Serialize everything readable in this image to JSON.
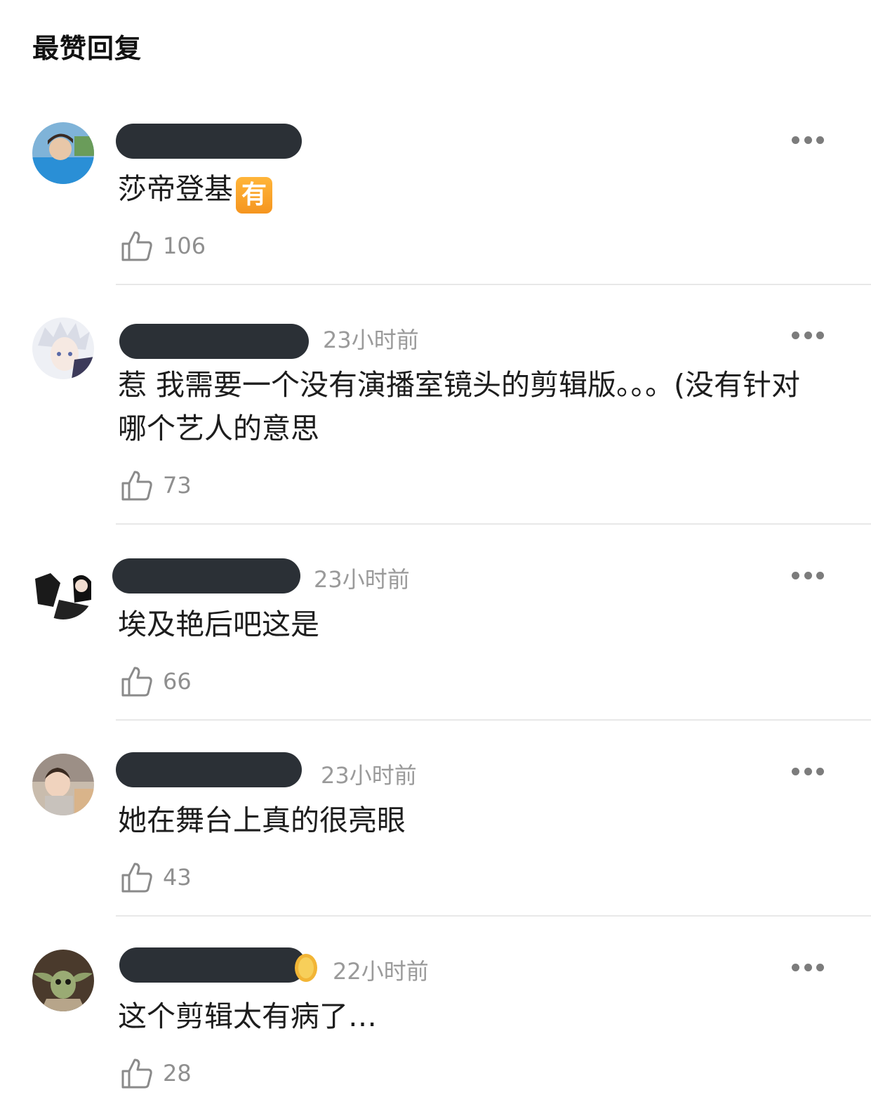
{
  "section_title": "最赞回复",
  "icons": {
    "like": "thumbs-up-icon",
    "more": "more-dots-icon"
  },
  "comments": [
    {
      "time": "",
      "text": "莎帝登基",
      "badge": "有",
      "likes": "106"
    },
    {
      "time": "23小时前",
      "text": "惹 我需要一个没有演播室镜头的剪辑版。。。(没有针对哪个艺人的意思",
      "likes": "73"
    },
    {
      "time": "23小时前",
      "text": "埃及艳后吧这是",
      "likes": "66"
    },
    {
      "time": "23小时前",
      "text": "她在舞台上真的很亮眼",
      "likes": "43"
    },
    {
      "time": "22小时前",
      "text": "这个剪辑太有病了…",
      "likes": "28"
    }
  ]
}
